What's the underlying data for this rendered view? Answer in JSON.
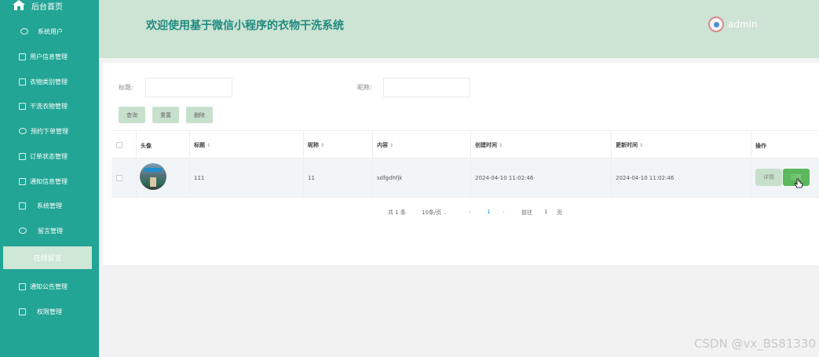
{
  "sidebar": {
    "home": "后台首页",
    "items": [
      {
        "label": "系统用户",
        "icon": "cloud-icon"
      },
      {
        "label": "用户信息管理",
        "icon": "edit-icon"
      },
      {
        "label": "衣物类别管理",
        "icon": "list-icon"
      },
      {
        "label": "干洗衣物管理",
        "icon": "edit-icon"
      },
      {
        "label": "预约下单管理",
        "icon": "cloud-icon"
      },
      {
        "label": "订单状态管理",
        "icon": "list-icon"
      },
      {
        "label": "通知信息管理",
        "icon": "box-icon"
      },
      {
        "label": "系统管理",
        "icon": "edit-icon"
      },
      {
        "label": "留言管理",
        "icon": "cloud-icon"
      }
    ],
    "sub_item": "在线留言",
    "items2": [
      {
        "label": "通知公告管理",
        "icon": "edit-icon"
      },
      {
        "label": "权限管理",
        "icon": "box-icon"
      }
    ]
  },
  "header": {
    "title": "欢迎使用基于微信小程序的衣物干洗系统",
    "username": "admin"
  },
  "search": {
    "title_label": "标题:",
    "title_placeholder": "",
    "nickname_label": "昵称:",
    "nickname_placeholder": "",
    "query_btn": "查询",
    "reset_btn": "重置",
    "delete_btn": "删除"
  },
  "table": {
    "headers": [
      "头像",
      "标题",
      "昵称",
      "内容",
      "创建时间",
      "更新时间",
      "操作"
    ],
    "sort_mark": "⇕",
    "rows": [
      {
        "title": "111",
        "nickname": "11",
        "content": "sdfgdhfjk",
        "created": "2024-04-10 11:02:46",
        "updated": "2024-04-10 11:02:46",
        "detail": "详情",
        "edit": "回复"
      }
    ]
  },
  "pagination": {
    "total": "共 1 条",
    "page_size": "10条/页",
    "prev": "‹",
    "current": "1",
    "next": "›",
    "goto": "前往",
    "goto_value": "1",
    "page_unit": "页"
  },
  "colors": {
    "sidebar": "#22a595",
    "header": "#cde3d3",
    "accent": "#5cb85c"
  },
  "watermark": "CSDN @vx_BS81330"
}
